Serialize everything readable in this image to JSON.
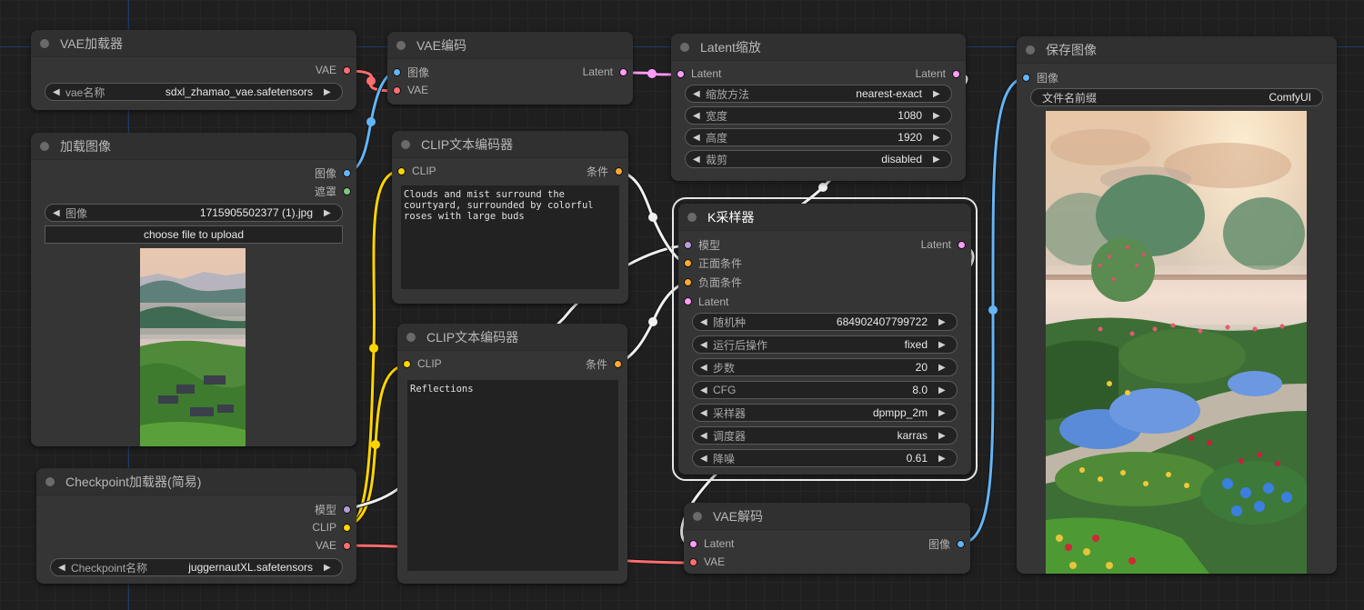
{
  "colors": {
    "vae": "#ff6e6e",
    "image": "#64b5f6",
    "mask": "#81c784",
    "latent": "#ff9cf9",
    "clip": "#ffd500",
    "conditioning": "#ffa931",
    "model": "#b39ddb",
    "link_white": "#f0f0f0"
  },
  "nodes": {
    "vae_loader": {
      "title": "VAE加载器",
      "outputs": [
        "VAE"
      ],
      "widgets": [
        {
          "label": "vae名称",
          "value": "sdxl_zhamao_vae.safetensors"
        }
      ]
    },
    "load_image": {
      "title": "加载图像",
      "outputs": [
        "图像",
        "遮罩"
      ],
      "widgets": [
        {
          "label": "图像",
          "value": "1715905502377 (1).jpg"
        }
      ],
      "upload_button": "choose file to upload",
      "preview": "misty mountain village at dawn"
    },
    "checkpoint_loader": {
      "title": "Checkpoint加载器(简易)",
      "outputs": [
        "模型",
        "CLIP",
        "VAE"
      ],
      "widgets": [
        {
          "label": "Checkpoint名称",
          "value": "juggernautXL.safetensors"
        }
      ]
    },
    "vae_encode": {
      "title": "VAE编码",
      "inputs": [
        "图像",
        "VAE"
      ],
      "outputs": [
        "Latent"
      ]
    },
    "clip_encode_positive": {
      "title": "CLIP文本编码器",
      "inputs": [
        "CLIP"
      ],
      "outputs": [
        "条件"
      ],
      "text": "Clouds and mist surround the\ncourtyard, surrounded by colorful\nroses with large buds"
    },
    "clip_encode_negative": {
      "title": "CLIP文本编码器",
      "inputs": [
        "CLIP"
      ],
      "outputs": [
        "条件"
      ],
      "text": "Reflections"
    },
    "latent_upscale": {
      "title": "Latent缩放",
      "inputs": [
        "Latent"
      ],
      "outputs": [
        "Latent"
      ],
      "widgets": [
        {
          "label": "缩放方法",
          "value": "nearest-exact"
        },
        {
          "label": "宽度",
          "value": "1080"
        },
        {
          "label": "高度",
          "value": "1920"
        },
        {
          "label": "裁剪",
          "value": "disabled"
        }
      ]
    },
    "ksampler": {
      "title": "K采样器",
      "inputs": [
        "模型",
        "正面条件",
        "负面条件",
        "Latent"
      ],
      "outputs": [
        "Latent"
      ],
      "widgets": [
        {
          "label": "随机种",
          "value": "684902407799722"
        },
        {
          "label": "运行后操作",
          "value": "fixed"
        },
        {
          "label": "步数",
          "value": "20"
        },
        {
          "label": "CFG",
          "value": "8.0"
        },
        {
          "label": "采样器",
          "value": "dpmpp_2m"
        },
        {
          "label": "调度器",
          "value": "karras"
        },
        {
          "label": "降噪",
          "value": "0.61"
        }
      ]
    },
    "vae_decode": {
      "title": "VAE解码",
      "inputs": [
        "Latent",
        "VAE"
      ],
      "outputs": [
        "图像"
      ]
    },
    "save_image": {
      "title": "保存图像",
      "inputs": [
        "图像"
      ],
      "widgets": [
        {
          "label": "文件名前缀",
          "value": "ComfyUI"
        }
      ],
      "preview": "misty rose garden courtyard"
    }
  }
}
